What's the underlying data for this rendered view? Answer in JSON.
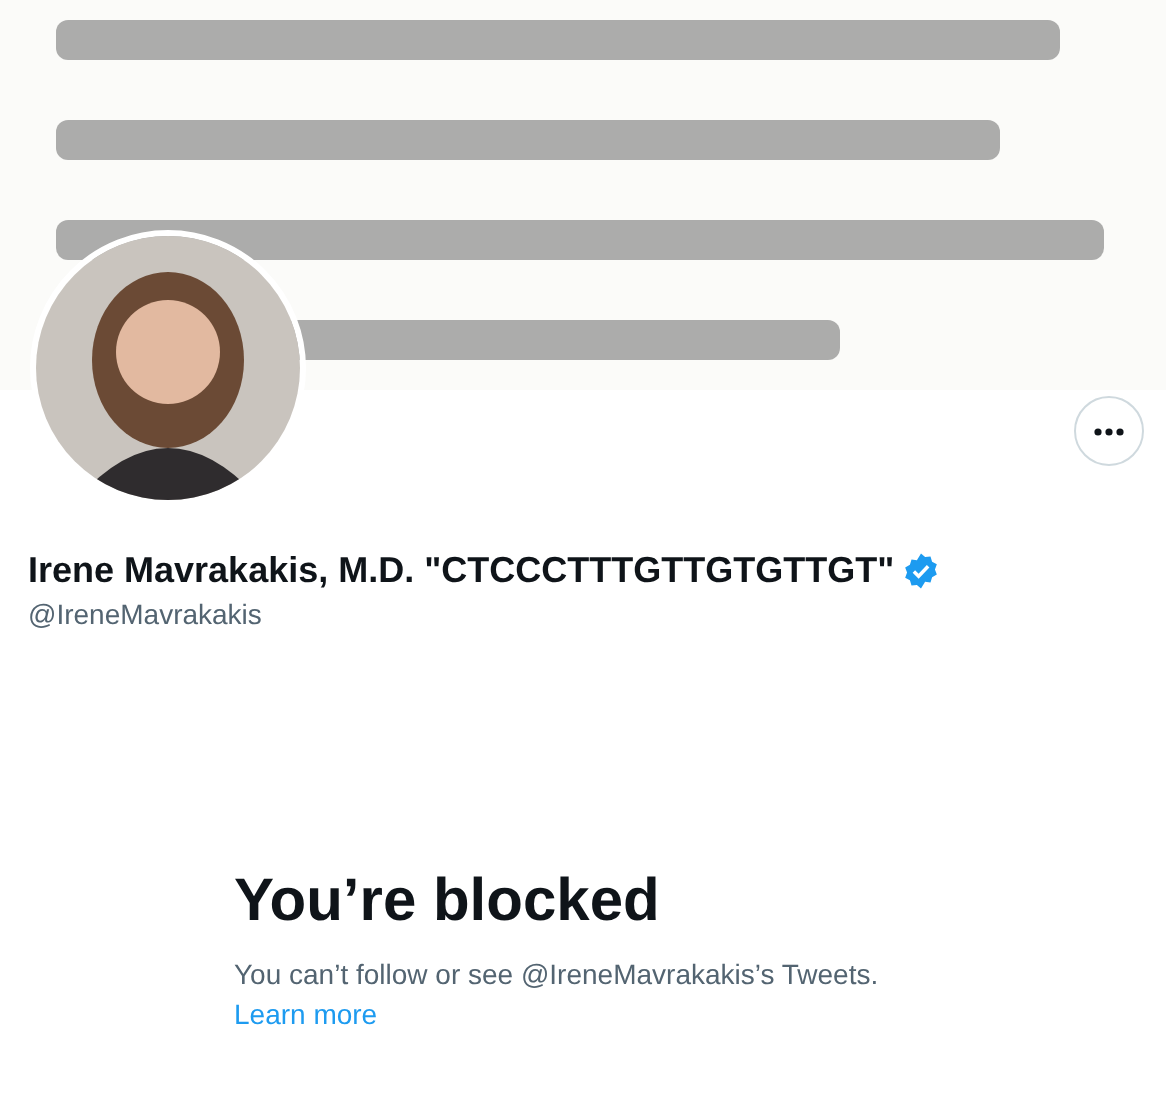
{
  "profile": {
    "name": "Irene Mavrakakis, M.D. \"CTCCCTTTGTTGTGTTGT\"",
    "verified": true,
    "handle": "@IreneMavrakakis"
  },
  "blocked": {
    "title": "You’re blocked",
    "message": "You can’t follow or see @IreneMavrakakis’s Tweets.",
    "link": "Learn more"
  }
}
